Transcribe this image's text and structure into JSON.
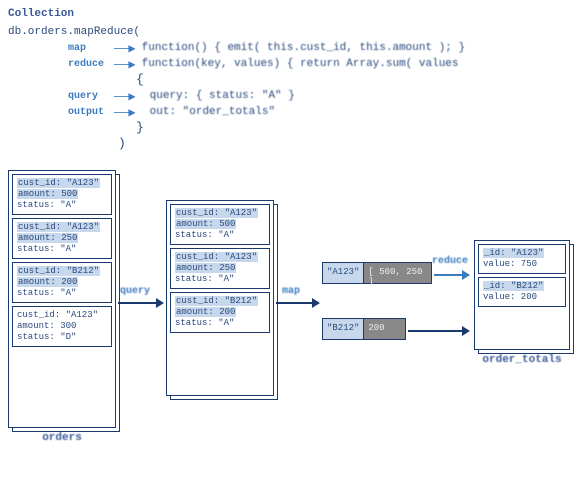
{
  "header": {
    "collection_label": "Collection",
    "method_call": "db.orders.mapReduce("
  },
  "annotations": {
    "map": {
      "label": "map",
      "code": "function() { emit( this.cust_id, this.amount ); }"
    },
    "reduce": {
      "label": "reduce",
      "code": "function(key, values) { return Array.sum( values"
    },
    "open_brace": "{",
    "query": {
      "label": "query",
      "code": "query: { status: \"A\" }"
    },
    "output": {
      "label": "output",
      "code": "out: \"order_totals\""
    },
    "close_brace": "}",
    "close_paren": ")"
  },
  "diagram": {
    "orders_label": "orders",
    "filtered_docs": [
      {
        "line1": "cust_id: \"A123\"",
        "line2": "amount: 500",
        "line3": "status: \"A\""
      },
      {
        "line1": "cust_id: \"A123\"",
        "line2": "amount: 250",
        "line3": "status: \"A\""
      },
      {
        "line1": "cust_id: \"B212\"",
        "line2": "amount: 200",
        "line3": "status: \"A\""
      }
    ],
    "orders_docs": [
      {
        "line1": "cust_id: \"A123\"",
        "line2": "amount: 500",
        "line3": "status: \"A\""
      },
      {
        "line1": "cust_id: \"A123\"",
        "line2": "amount: 250",
        "line3": "status: \"A\""
      },
      {
        "line1": "cust_id: \"B212\"",
        "line2": "amount: 200",
        "line3": "status: \"A\""
      },
      {
        "line1": "cust_id: \"A123\"",
        "line2": "amount: 300",
        "line3": "status: \"D\""
      }
    ],
    "kv_a": {
      "key": "\"A123\"",
      "val": "[ 500, 250 ]"
    },
    "kv_b": {
      "key": "\"B212\"",
      "val": "200"
    },
    "result_a": {
      "line1": "_id: \"A123\"",
      "line2": "value: 750"
    },
    "result_b": {
      "line1": "_id: \"B212\"",
      "line2": "value: 200"
    },
    "result_label": "order_totals",
    "flow": {
      "query": "query",
      "map": "map",
      "reduce": "reduce"
    }
  }
}
